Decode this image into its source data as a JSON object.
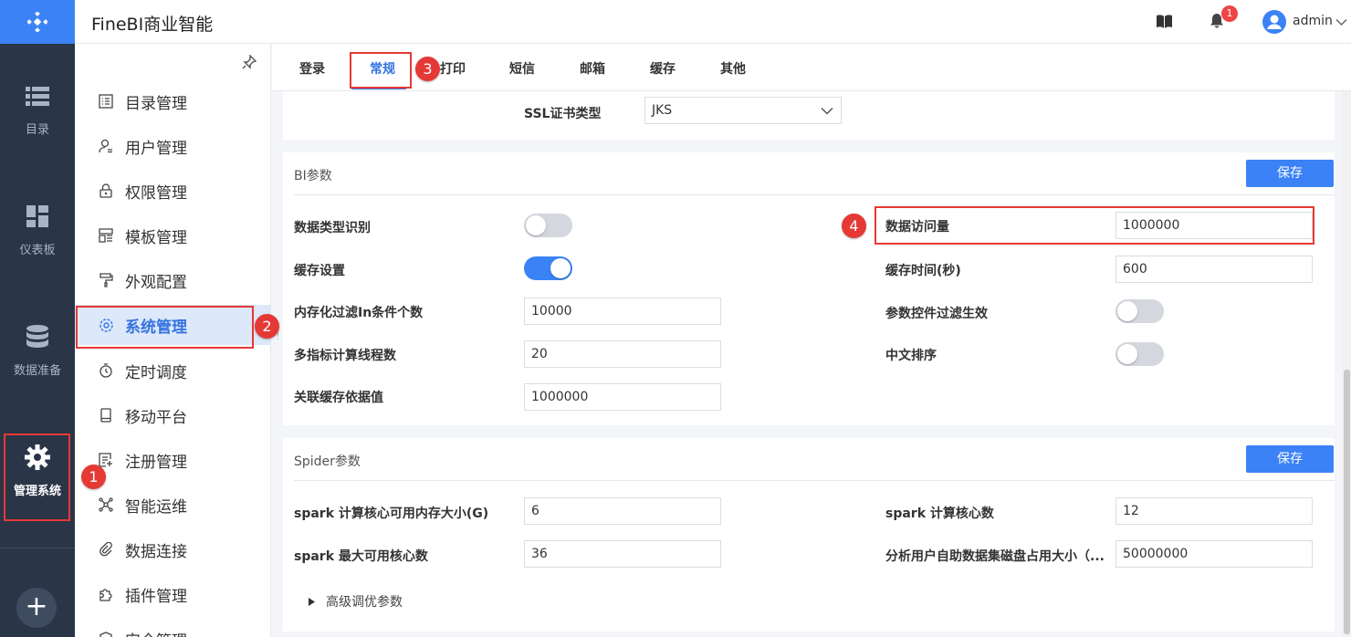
{
  "app": {
    "title": "FineBI商业智能"
  },
  "topbar": {
    "notification_count": "1",
    "user": "admin"
  },
  "rail": {
    "items": [
      {
        "label": "目录",
        "icon": "list-icon"
      },
      {
        "label": "仪表板",
        "icon": "dashboard-icon"
      },
      {
        "label": "数据准备",
        "icon": "database-icon"
      },
      {
        "label": "管理系统",
        "icon": "gear-icon"
      }
    ],
    "plus": "+"
  },
  "menu": {
    "items": [
      {
        "label": "目录管理",
        "icon": "catalog-icon"
      },
      {
        "label": "用户管理",
        "icon": "user-icon"
      },
      {
        "label": "权限管理",
        "icon": "lock-icon"
      },
      {
        "label": "模板管理",
        "icon": "template-icon"
      },
      {
        "label": "外观配置",
        "icon": "paint-icon"
      },
      {
        "label": "系统管理",
        "icon": "settings-icon"
      },
      {
        "label": "定时调度",
        "icon": "timer-icon"
      },
      {
        "label": "移动平台",
        "icon": "mobile-icon"
      },
      {
        "label": "注册管理",
        "icon": "register-icon"
      },
      {
        "label": "智能运维",
        "icon": "ops-icon"
      },
      {
        "label": "数据连接",
        "icon": "link-icon"
      },
      {
        "label": "插件管理",
        "icon": "plugin-icon"
      },
      {
        "label": "安全管理",
        "icon": "shield-icon"
      }
    ]
  },
  "tabs": [
    "登录",
    "常规",
    "打印",
    "短信",
    "邮箱",
    "缓存",
    "其他"
  ],
  "ssl": {
    "label": "SSL证书类型",
    "value": "JKS"
  },
  "bi": {
    "title": "BI参数",
    "save": "保存",
    "data_type_label": "数据类型识别",
    "data_type_on": false,
    "cache_label": "缓存设置",
    "cache_on": true,
    "filter_label": "内存化过滤In条件个数",
    "filter_value": "10000",
    "threads_label": "多指标计算线程数",
    "threads_value": "20",
    "relation_label": "关联缓存依据值",
    "relation_value": "1000000",
    "access_label": "数据访问量",
    "access_value": "1000000",
    "cache_time_label": "缓存时间(秒)",
    "cache_time_value": "600",
    "param_filter_label": "参数控件过滤生效",
    "param_filter_on": false,
    "chinese_sort_label": "中文排序",
    "chinese_sort_on": false
  },
  "spider": {
    "title": "Spider参数",
    "save": "保存",
    "mem_label": "spark 计算核心可用内存大小(G)",
    "mem_value": "6",
    "cores_label": "spark 计算核心数",
    "cores_value": "12",
    "max_cores_label": "spark 最大可用核心数",
    "max_cores_value": "36",
    "disk_label": "分析用户自助数据集磁盘占用大小（...",
    "disk_value": "50000000",
    "advanced": "高级调优参数"
  },
  "steps": [
    "1",
    "2",
    "3",
    "4"
  ],
  "colors": {
    "accent": "#3b82f6",
    "rail": "#2a3547",
    "highlight": "#e53935"
  }
}
